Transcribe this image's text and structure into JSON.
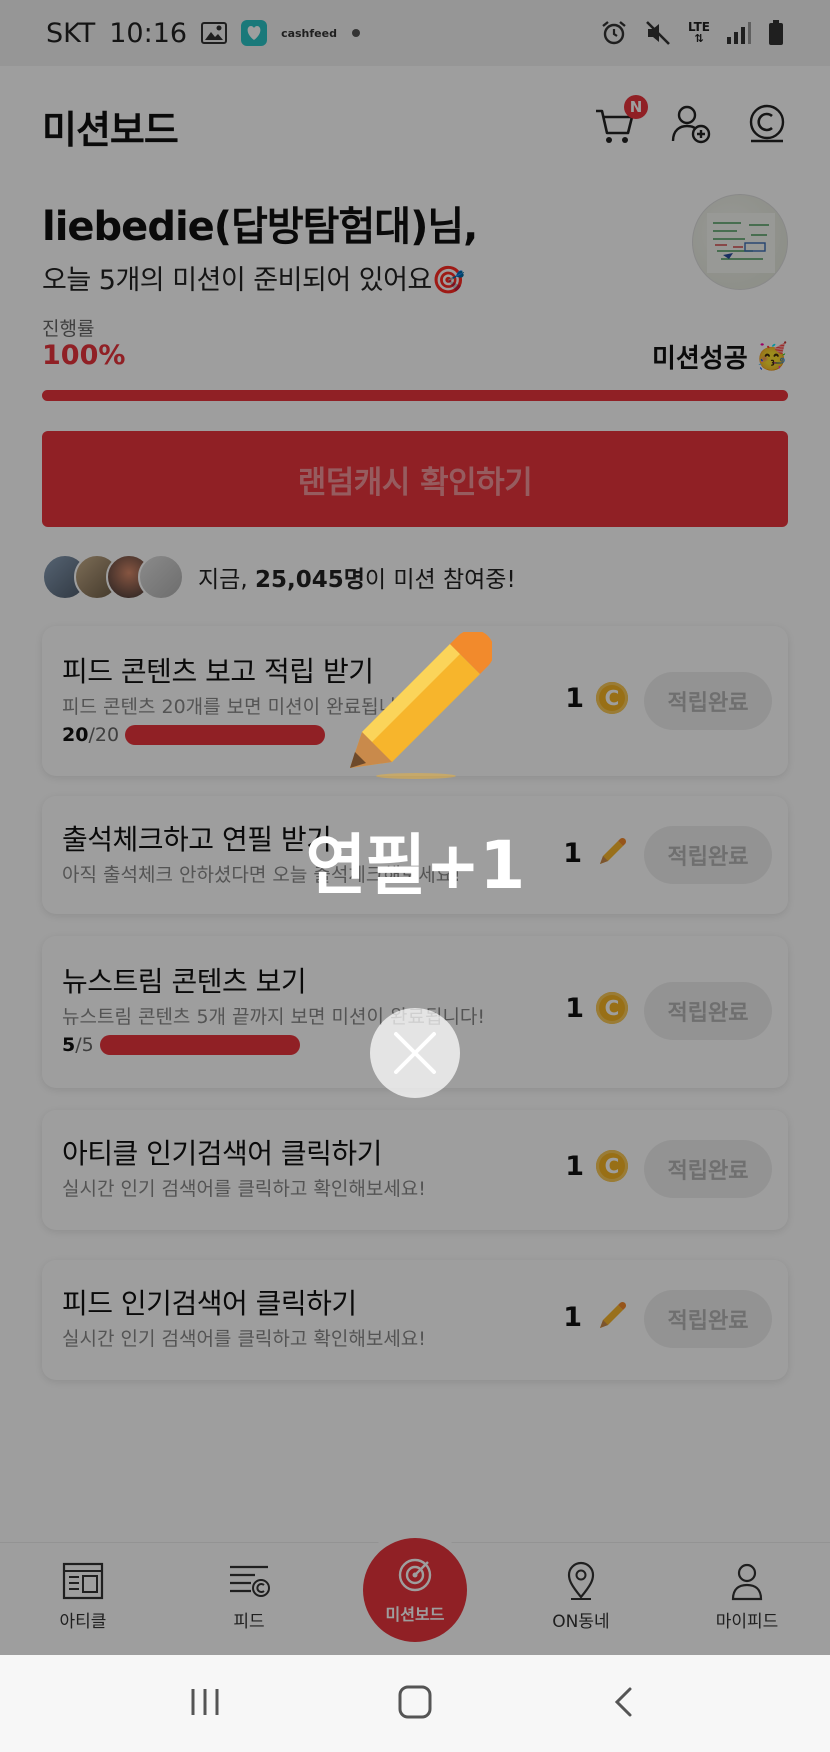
{
  "status_bar": {
    "carrier": "SKT",
    "time": "10:16",
    "cashfeed_line1": "cash",
    "cashfeed_line2": "feed",
    "network": "LTE"
  },
  "header": {
    "title": "미션보드",
    "cart_badge": "N"
  },
  "greeting": {
    "name": "liebedie(답방탐험대)님,",
    "subtitle": "오늘 5개의 미션이 준비되어 있어요🎯"
  },
  "progress": {
    "label": "진행률",
    "value": "100%",
    "fraction": 1.0,
    "status": "미션성공",
    "status_emoji": "🥳"
  },
  "random_cash_button": "랜덤캐시 확인하기",
  "participants": {
    "prefix": "지금, ",
    "count": "25,045명",
    "suffix": "이 미션 참여중!"
  },
  "missions": [
    {
      "title": "피드 콘텐츠 보고 적립 받기",
      "desc": "피드 콘텐츠 20개를 보면 미션이 완료됩니다!",
      "count_done": "20",
      "count_total": "/20",
      "fraction": 1.0,
      "reward": "1",
      "reward_icon": "coin-icon",
      "button": "적립완료"
    },
    {
      "title": "출석체크하고 연필 받기",
      "desc": "아직 출석체크 안하셨다면 오늘 출석체크해보세요!",
      "reward": "1",
      "reward_icon": "pencil-icon",
      "button": "적립완료"
    },
    {
      "title": "뉴스트림 콘텐츠 보기",
      "desc": "뉴스트림 콘텐츠 5개 끝까지 보면 미션이 완료됩니다!",
      "count_done": "5",
      "count_total": "/5",
      "fraction": 1.0,
      "reward": "1",
      "reward_icon": "coin-icon",
      "button": "적립완료"
    },
    {
      "title": "아티클 인기검색어 클릭하기",
      "desc": "실시간 인기 검색어를 클릭하고 확인해보세요!",
      "reward": "1",
      "reward_icon": "coin-icon",
      "button": "적립완료"
    },
    {
      "title": "피드 인기검색어 클릭하기",
      "desc": "실시간 인기 검색어를 클릭하고 확인해보세요!",
      "reward": "1",
      "reward_icon": "pencil-icon",
      "button": "적립완료"
    }
  ],
  "coin_symbol": "C",
  "bottom_nav": {
    "article": "아티클",
    "feed": "피드",
    "mission": "미션보드",
    "on_town": "ON동네",
    "my_feed": "마이피드"
  },
  "popup": {
    "text": "연필+1",
    "icon": "pencil-icon"
  },
  "colors": {
    "accent": "#e8343c",
    "coin": "#f6b324",
    "pencil": "#f7b52c"
  }
}
